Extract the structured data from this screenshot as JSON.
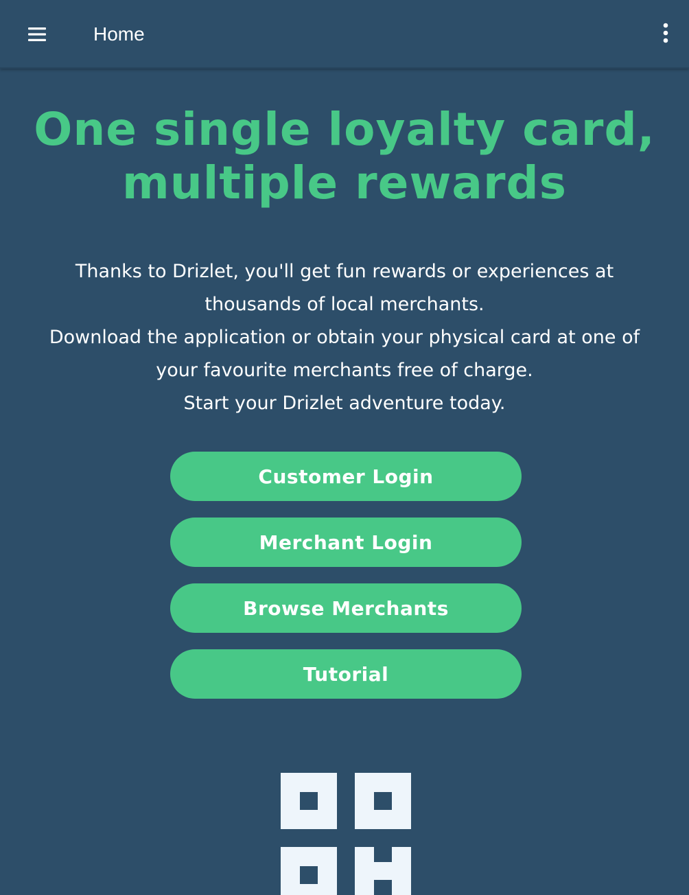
{
  "header": {
    "title": "Home",
    "menu_icon": "hamburger-menu-icon",
    "more_icon": "more-vertical-icon"
  },
  "hero": {
    "title_line1": "One single loyalty card,",
    "title_line2": "multiple rewards"
  },
  "intro": {
    "line1": "Thanks to Drizlet, you'll get fun rewards or experiences at",
    "line2": "thousands of local merchants.",
    "line3": "Download the application or obtain your physical card at one of",
    "line4": "your favourite merchants free of charge.",
    "line5": "Start your Drizlet adventure today."
  },
  "actions": {
    "customer_login": "Customer Login",
    "merchant_login": "Merchant Login",
    "browse_merchants": "Browse Merchants",
    "tutorial": "Tutorial"
  },
  "logo": {
    "icon": "drizlet-qr-logo"
  },
  "colors": {
    "background": "#2d4e69",
    "accent": "#48c887",
    "text": "#ffffff",
    "logo": "#eef5fb"
  }
}
